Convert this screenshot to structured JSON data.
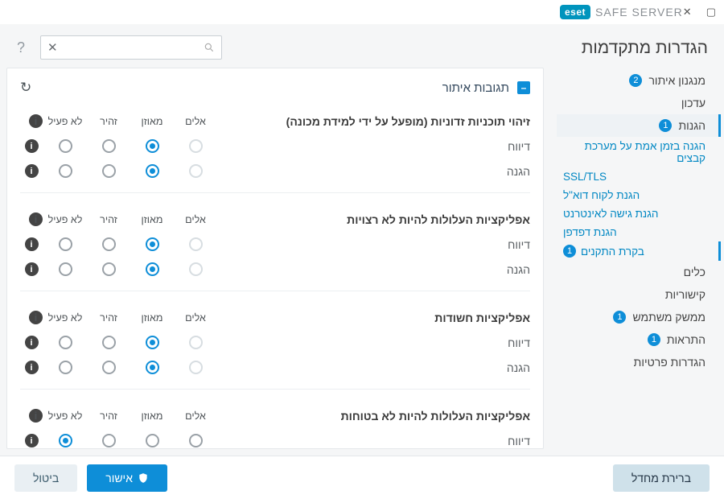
{
  "brand": {
    "eset": "eset",
    "product": "SAFE SERVER"
  },
  "page_title": "הגדרות מתקדמות",
  "search": {
    "value": "",
    "placeholder": ""
  },
  "sidebar": {
    "items": [
      {
        "label": "מנגנון איתור",
        "badge": "2"
      },
      {
        "label": "עדכון"
      },
      {
        "label": "הגנות",
        "badge": "1"
      },
      {
        "label": "כלים"
      },
      {
        "label": "קישוריות"
      },
      {
        "label": "ממשק משתמש",
        "badge": "1"
      },
      {
        "label": "התראות",
        "badge": "1"
      },
      {
        "label": "הגדרות פרטיות"
      }
    ],
    "protections_sub": [
      {
        "label": "הגנה בזמן אמת על מערכת קבצים"
      },
      {
        "label": "SSL/TLS"
      },
      {
        "label": "הגנת לקוח דוא\"ל"
      },
      {
        "label": "הגנת גישה לאינטרנט"
      },
      {
        "label": "הגנת דפדפן"
      },
      {
        "label": "בקרת התקנים",
        "badge": "1"
      }
    ]
  },
  "panel": {
    "title": "תגובות איתור"
  },
  "levels": {
    "aggressive": "אלים",
    "balanced": "מאוזן",
    "cautious": "זהיר",
    "off": "לא פעיל"
  },
  "groups": [
    {
      "title": "זיהוי תוכניות זדוניות (מופעל על ידי למידת מכונה)",
      "rows": [
        {
          "label": "דיווח",
          "sel": "balanced",
          "ghost": "aggressive"
        },
        {
          "label": "הגנה",
          "sel": "balanced",
          "ghost": "aggressive"
        }
      ]
    },
    {
      "title": "אפליקציות העלולות להיות לא רצויות",
      "rows": [
        {
          "label": "דיווח",
          "sel": "balanced",
          "ghost": "aggressive"
        },
        {
          "label": "הגנה",
          "sel": "balanced",
          "ghost": "aggressive"
        }
      ]
    },
    {
      "title": "אפליקציות חשודות",
      "rows": [
        {
          "label": "דיווח",
          "sel": "balanced",
          "ghost": "aggressive"
        },
        {
          "label": "הגנה",
          "sel": "balanced",
          "ghost": "aggressive"
        }
      ]
    },
    {
      "title": "אפליקציות העלולות להיות לא בטוחות",
      "rows": [
        {
          "label": "דיווח",
          "sel": "off"
        }
      ]
    }
  ],
  "footer": {
    "default": "ברירת מחדל",
    "ok": "אישור",
    "cancel": "ביטול"
  }
}
